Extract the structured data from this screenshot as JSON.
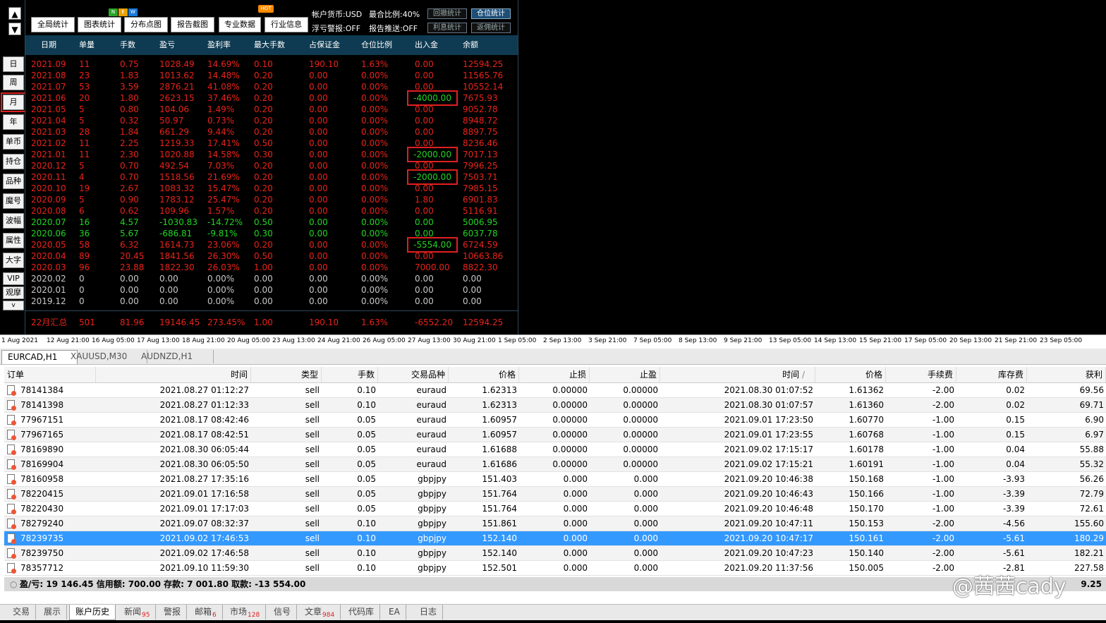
{
  "nav": {
    "up": "▲",
    "down": "▼"
  },
  "side_buttons": [
    "日",
    "周",
    "月",
    "年",
    "单币",
    "持仓",
    "品种",
    "魔号",
    "波幅",
    "属性",
    "大字",
    "VIP",
    "观摩"
  ],
  "side_more": "v",
  "toolbar": {
    "buttons": [
      "全局统计",
      "图表统计",
      "分布点图",
      "报告截图",
      "专业数据",
      "行业信息"
    ],
    "new_badge": [
      "N",
      "E",
      "W"
    ],
    "hot_badge": "HOT",
    "info": {
      "currency": "帐户货币:USD",
      "max_ratio": "最合比例:40%",
      "float_alert": "浮亏警报:OFF",
      "report_push": "报告推送:OFF"
    },
    "stat_buttons": [
      "回撤统计",
      "仓位统计",
      "利息统计",
      "返佣统计"
    ]
  },
  "monthly_table": {
    "headers": [
      "日期",
      "单量",
      "手数",
      "盈亏",
      "盈利率",
      "最大手数",
      "占保证金",
      "仓位比例",
      "出入金",
      "余额"
    ],
    "rows": [
      {
        "tone": "red",
        "cells": [
          "2021.09",
          "11",
          "0.75",
          "1028.49",
          "14.69%",
          "0.10",
          "190.10",
          "1.63%",
          "0.00",
          "12594.25"
        ]
      },
      {
        "tone": "red",
        "cells": [
          "2021.08",
          "23",
          "1.83",
          "1013.62",
          "14.48%",
          "0.20",
          "0.00",
          "0.00%",
          "0.00",
          "11565.76"
        ]
      },
      {
        "tone": "red",
        "cells": [
          "2021.07",
          "53",
          "3.59",
          "2876.21",
          "41.08%",
          "0.20",
          "0.00",
          "0.00%",
          "0.00",
          "10552.14"
        ]
      },
      {
        "tone": "red",
        "cells": [
          "2021.06",
          "20",
          "1.80",
          "2623.15",
          "37.46%",
          "0.20",
          "0.00",
          "0.00%",
          "-4000.00",
          "7675.93"
        ],
        "boxed": true
      },
      {
        "tone": "red",
        "cells": [
          "2021.05",
          "5",
          "0.80",
          "104.06",
          "1.49%",
          "0.20",
          "0.00",
          "0.00%",
          "0.00",
          "9052.78"
        ]
      },
      {
        "tone": "red",
        "cells": [
          "2021.04",
          "5",
          "0.32",
          "50.97",
          "0.73%",
          "0.20",
          "0.00",
          "0.00%",
          "0.00",
          "8948.72"
        ]
      },
      {
        "tone": "red",
        "cells": [
          "2021.03",
          "28",
          "1.84",
          "661.29",
          "9.44%",
          "0.20",
          "0.00",
          "0.00%",
          "0.00",
          "8897.75"
        ]
      },
      {
        "tone": "red",
        "cells": [
          "2021.02",
          "11",
          "2.25",
          "1219.33",
          "17.41%",
          "0.50",
          "0.00",
          "0.00%",
          "0.00",
          "8236.46"
        ]
      },
      {
        "tone": "red",
        "cells": [
          "2021.01",
          "11",
          "2.30",
          "1020.88",
          "14.58%",
          "0.30",
          "0.00",
          "0.00%",
          "-2000.00",
          "7017.13"
        ],
        "boxed": true
      },
      {
        "tone": "red",
        "cells": [
          "2020.12",
          "5",
          "0.70",
          "492.54",
          "7.03%",
          "0.20",
          "0.00",
          "0.00%",
          "0.00",
          "7996.25"
        ]
      },
      {
        "tone": "red",
        "cells": [
          "2020.11",
          "4",
          "0.70",
          "1518.56",
          "21.69%",
          "0.20",
          "0.00",
          "0.00%",
          "-2000.00",
          "7503.71"
        ],
        "boxed": true
      },
      {
        "tone": "red",
        "cells": [
          "2020.10",
          "19",
          "2.67",
          "1083.32",
          "15.47%",
          "0.20",
          "0.00",
          "0.00%",
          "0.00",
          "7985.15"
        ]
      },
      {
        "tone": "red",
        "cells": [
          "2020.09",
          "5",
          "0.90",
          "1783.12",
          "25.47%",
          "0.20",
          "0.00",
          "0.00%",
          "1.80",
          "6901.83"
        ]
      },
      {
        "tone": "red",
        "cells": [
          "2020.08",
          "6",
          "0.62",
          "109.96",
          "1.57%",
          "0.20",
          "0.00",
          "0.00%",
          "0.00",
          "5116.91"
        ]
      },
      {
        "tone": "green",
        "cells": [
          "2020.07",
          "16",
          "4.57",
          "-1030.83",
          "-14.72%",
          "0.50",
          "0.00",
          "0.00%",
          "0.00",
          "5006.95"
        ]
      },
      {
        "tone": "green",
        "cells": [
          "2020.06",
          "36",
          "5.67",
          "-686.81",
          "-9.81%",
          "0.30",
          "0.00",
          "0.00%",
          "0.00",
          "6037.78"
        ]
      },
      {
        "tone": "red",
        "cells": [
          "2020.05",
          "58",
          "6.32",
          "1614.73",
          "23.06%",
          "0.20",
          "0.00",
          "0.00%",
          "-5554.00",
          "6724.59"
        ],
        "boxed": true
      },
      {
        "tone": "red",
        "cells": [
          "2020.04",
          "89",
          "20.45",
          "1841.56",
          "26.30%",
          "0.50",
          "0.00",
          "0.00%",
          "0.00",
          "10663.86"
        ]
      },
      {
        "tone": "red",
        "cells": [
          "2020.03",
          "96",
          "23.88",
          "1822.30",
          "26.03%",
          "1.00",
          "0.00",
          "0.00%",
          "7000.00",
          "8822.30"
        ]
      },
      {
        "tone": "gray",
        "cells": [
          "2020.02",
          "0",
          "0.00",
          "0.00",
          "0.00%",
          "0.00",
          "0.00",
          "0.00%",
          "0.00",
          "0.00"
        ]
      },
      {
        "tone": "gray",
        "cells": [
          "2020.01",
          "0",
          "0.00",
          "0.00",
          "0.00%",
          "0.00",
          "0.00",
          "0.00%",
          "0.00",
          "0.00"
        ]
      },
      {
        "tone": "gray",
        "cells": [
          "2019.12",
          "0",
          "0.00",
          "0.00",
          "0.00%",
          "0.00",
          "0.00",
          "0.00%",
          "0.00",
          "0.00"
        ]
      }
    ],
    "summary": [
      "22月汇总",
      "501",
      "81.96",
      "19146.45",
      "273.45%",
      "1.00",
      "190.10",
      "1.63%",
      "-6552.20",
      "12594.25"
    ]
  },
  "time_axis": [
    "1 Aug 2021",
    "12 Aug 21:00",
    "16 Aug 05:00",
    "17 Aug 13:00",
    "18 Aug 21:00",
    "20 Aug 05:00",
    "23 Aug 13:00",
    "24 Aug 21:00",
    "26 Aug 05:00",
    "27 Aug 13:00",
    "30 Aug 21:00",
    "1 Sep 05:00",
    "2 Sep 13:00",
    "3 Sep 21:00",
    "7 Sep 05:00",
    "8 Sep 13:00",
    "9 Sep 21:00",
    "13 Sep 05:00",
    "14 Sep 13:00",
    "15 Sep 21:00",
    "17 Sep 05:00",
    "20 Sep 13:00",
    "21 Sep 21:00",
    "23 Sep 05:00"
  ],
  "chart_tabs": [
    "EURCAD,H1",
    "XAUUSD,M30",
    "AUDNZD,H1"
  ],
  "history": {
    "headers": [
      "订单",
      "时间",
      "类型",
      "手数",
      "交易品种",
      "价格",
      "止损",
      "止盈",
      "时间",
      "价格",
      "手续费",
      "库存费",
      "获利"
    ],
    "sort_mark": "/",
    "rows": [
      [
        "78141384",
        "2021.08.27 01:12:27",
        "sell",
        "0.10",
        "euraud",
        "1.62313",
        "0.00000",
        "0.00000",
        "2021.08.30 01:07:52",
        "1.61362",
        "-2.00",
        "0.02",
        "69.56"
      ],
      [
        "78141398",
        "2021.08.27 01:12:33",
        "sell",
        "0.10",
        "euraud",
        "1.62313",
        "0.00000",
        "0.00000",
        "2021.08.30 01:07:57",
        "1.61360",
        "-2.00",
        "0.02",
        "69.71"
      ],
      [
        "77967151",
        "2021.08.17 08:42:46",
        "sell",
        "0.05",
        "euraud",
        "1.60957",
        "0.00000",
        "0.00000",
        "2021.09.01 17:23:50",
        "1.60770",
        "-1.00",
        "0.15",
        "6.90"
      ],
      [
        "77967165",
        "2021.08.17 08:42:51",
        "sell",
        "0.05",
        "euraud",
        "1.60957",
        "0.00000",
        "0.00000",
        "2021.09.01 17:23:55",
        "1.60768",
        "-1.00",
        "0.15",
        "6.97"
      ],
      [
        "78169890",
        "2021.08.30 06:05:44",
        "sell",
        "0.05",
        "euraud",
        "1.61688",
        "0.00000",
        "0.00000",
        "2021.09.02 17:15:17",
        "1.60178",
        "-1.00",
        "0.04",
        "55.88"
      ],
      [
        "78169904",
        "2021.08.30 06:05:50",
        "sell",
        "0.05",
        "euraud",
        "1.61686",
        "0.00000",
        "0.00000",
        "2021.09.02 17:15:21",
        "1.60191",
        "-1.00",
        "0.04",
        "55.32"
      ],
      [
        "78160958",
        "2021.08.27 17:35:16",
        "sell",
        "0.05",
        "gbpjpy",
        "151.403",
        "0.000",
        "0.000",
        "2021.09.20 10:46:38",
        "150.168",
        "-1.00",
        "-3.93",
        "56.26"
      ],
      [
        "78220415",
        "2021.09.01 17:16:58",
        "sell",
        "0.05",
        "gbpjpy",
        "151.764",
        "0.000",
        "0.000",
        "2021.09.20 10:46:43",
        "150.166",
        "-1.00",
        "-3.39",
        "72.79"
      ],
      [
        "78220430",
        "2021.09.01 17:17:03",
        "sell",
        "0.05",
        "gbpjpy",
        "151.764",
        "0.000",
        "0.000",
        "2021.09.20 10:46:48",
        "150.170",
        "-1.00",
        "-3.39",
        "72.61"
      ],
      [
        "78279240",
        "2021.09.07 08:32:37",
        "sell",
        "0.10",
        "gbpjpy",
        "151.861",
        "0.000",
        "0.000",
        "2021.09.20 10:47:11",
        "150.153",
        "-2.00",
        "-4.56",
        "155.60"
      ],
      [
        "78239735",
        "2021.09.02 17:46:53",
        "sell",
        "0.10",
        "gbpjpy",
        "152.140",
        "0.000",
        "0.000",
        "2021.09.20 10:47:17",
        "150.161",
        "-2.00",
        "-5.61",
        "180.29"
      ],
      [
        "78239750",
        "2021.09.02 17:46:58",
        "sell",
        "0.10",
        "gbpjpy",
        "152.140",
        "0.000",
        "0.000",
        "2021.09.20 10:47:23",
        "150.140",
        "-2.00",
        "-5.61",
        "182.21"
      ],
      [
        "78357712",
        "2021.09.10 11:59:30",
        "sell",
        "0.10",
        "gbpjpy",
        "152.501",
        "0.000",
        "0.000",
        "2021.09.20 11:37:56",
        "150.005",
        "-2.00",
        "-2.81",
        "227.58"
      ]
    ],
    "selected_index": 10,
    "summary": "盈/亏: 19 146.45  信用额: 700.00  存款: 7 001.80  取款: -13 554.00",
    "summary_tail": "9.25"
  },
  "bottom_tabs": [
    {
      "label": "交易",
      "badge": ""
    },
    {
      "label": "展示",
      "badge": ""
    },
    {
      "label": "账户历史",
      "badge": "",
      "active": true
    },
    {
      "label": "新闻",
      "badge": "95"
    },
    {
      "label": "警报",
      "badge": ""
    },
    {
      "label": "邮箱",
      "badge": "6"
    },
    {
      "label": "市场",
      "badge": "128"
    },
    {
      "label": "信号",
      "badge": ""
    },
    {
      "label": "文章",
      "badge": "984"
    },
    {
      "label": "代码库",
      "badge": ""
    },
    {
      "label": "EA",
      "badge": ""
    },
    {
      "label": "日志",
      "badge": ""
    }
  ],
  "watermark": "@茜茜cady",
  "colors": {
    "header_bg": "#0e3b52",
    "red": "#e8231a",
    "green": "#21d421",
    "selected": "#3399ff",
    "highlight_box": "#e02020"
  }
}
